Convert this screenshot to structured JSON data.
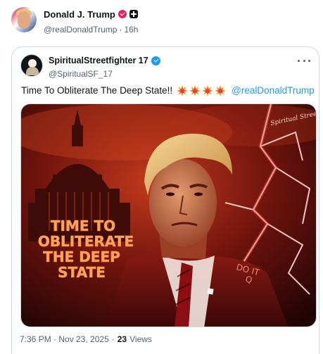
{
  "post": {
    "author_name": "Donald J. Trump",
    "handle": "@realDonaldTrump",
    "separator": "·",
    "time_ago": "16h"
  },
  "quoted": {
    "author_name": "SpiritualStreetfighter 17",
    "handle": "@SpiritualSF_17",
    "text": "Time To Obliterate The Deep State!!",
    "emoji_count": 4,
    "mention": "@realDonaldTrump",
    "image": {
      "overlay_lines": [
        "TIME TO",
        "OBLITERATE",
        "THE DEEP",
        "STATE"
      ],
      "signature_text": "Spiritual Streetfighter",
      "lapel_text": [
        "DO IT",
        "Q"
      ]
    },
    "timestamp": "7:36 PM · Nov 23, 2025",
    "separator": "·",
    "views_count": "23",
    "views_label": "Views"
  },
  "colors": {
    "accent": "#1d9bf0",
    "text_secondary": "#536471",
    "border": "#cfd9de",
    "badge_pink": "#e0245e"
  },
  "icons": [
    "verified-badge-icon",
    "affiliate-badge-icon",
    "more-icon",
    "collision-emoji-icon"
  ]
}
